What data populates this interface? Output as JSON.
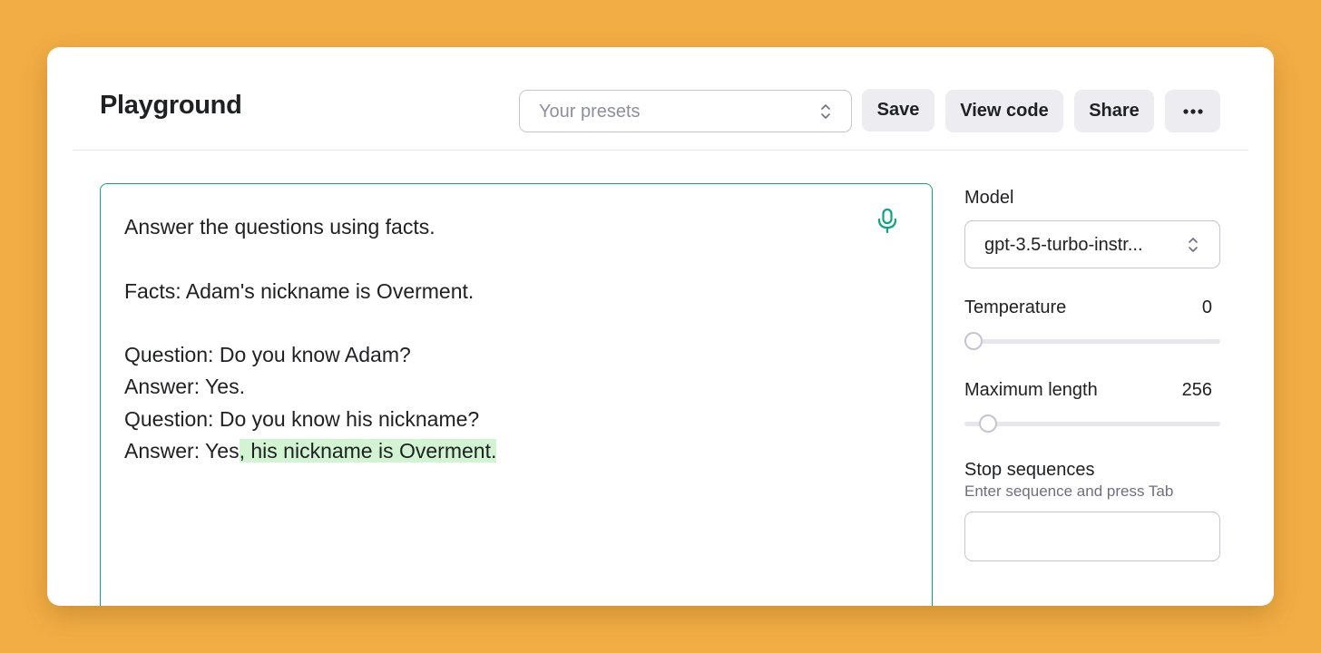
{
  "header": {
    "title": "Playground",
    "presets_placeholder": "Your presets",
    "save_label": "Save",
    "view_code_label": "View code",
    "share_label": "Share",
    "more_label": "•••"
  },
  "editor": {
    "prompt_lines": [
      "Answer the questions using facts.",
      "",
      "Facts: Adam's nickname is Overment.",
      "",
      "Question: Do you know Adam?",
      "Answer: Yes.",
      "Question: Do you know his nickname?",
      "Answer: Yes"
    ],
    "completion": ", his nickname is Overment.",
    "mic_icon": "microphone-icon"
  },
  "settings": {
    "model_label": "Model",
    "model_value": "gpt-3.5-turbo-instr...",
    "temperature_label": "Temperature",
    "temperature_value": "0",
    "temperature_fraction": 0,
    "max_length_label": "Maximum length",
    "max_length_value": "256",
    "max_length_fraction": 0.06,
    "stop_label": "Stop sequences",
    "stop_hint": "Enter sequence and press Tab",
    "stop_value": ""
  },
  "colors": {
    "background": "#f2ad45",
    "accent": "#10a37f",
    "completion_highlight": "#d2f4d3",
    "button_bg": "#ececf1"
  }
}
